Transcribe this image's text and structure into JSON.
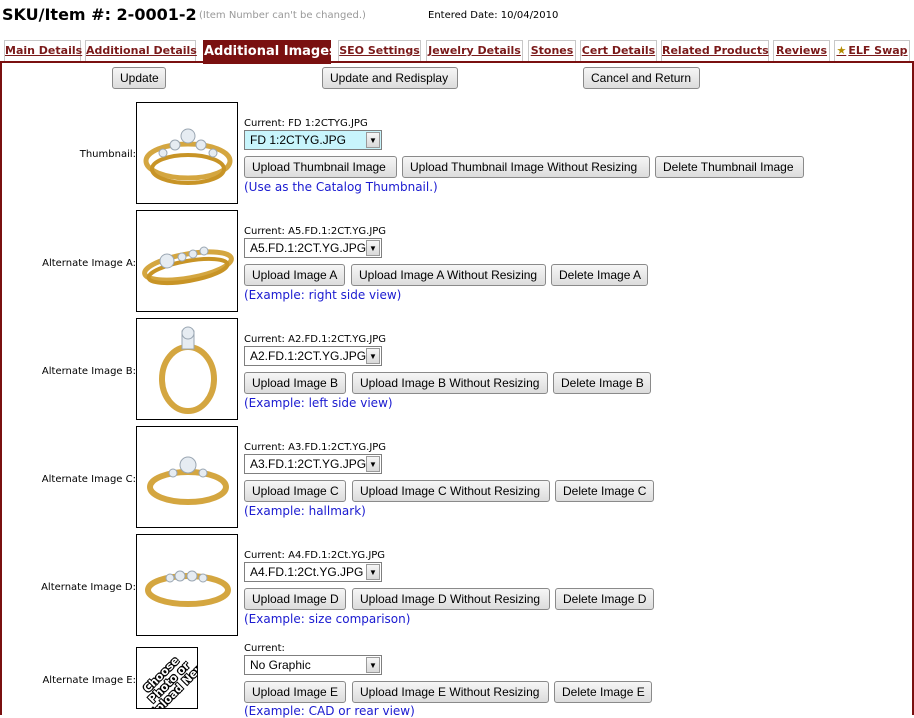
{
  "header": {
    "sku_title": "SKU/Item #: 2-0001-2",
    "sku_note": "(Item Number can't be changed.)",
    "entered_date": "Entered Date: 10/04/2010"
  },
  "tabs": [
    {
      "label": "Main Details"
    },
    {
      "label": "Additional Details"
    },
    {
      "label": "Additional Images",
      "active": true
    },
    {
      "label": "SEO Settings"
    },
    {
      "label": "Jewelry Details"
    },
    {
      "label": "Stones"
    },
    {
      "label": "Cert Details"
    },
    {
      "label": "Related Products"
    },
    {
      "label": "Reviews"
    },
    {
      "label": "ELF Swap",
      "icon": "star-icon"
    }
  ],
  "actions": {
    "update": "Update",
    "update_redisplay": "Update and Redisplay",
    "cancel_return": "Cancel and Return"
  },
  "rows": [
    {
      "label": "Thumbnail:",
      "current": "Current: FD 1:2CTYG.JPG",
      "selected": "FD 1:2CTYG.JPG",
      "btn_upload": "Upload Thumbnail Image",
      "btn_upload_nr": "Upload Thumbnail Image Without Resizing",
      "btn_delete": "Delete Thumbnail Image",
      "hint": "(Use as the Catalog Thumbnail.)"
    },
    {
      "label": "Alternate Image A:",
      "current": "Current: A5.FD.1:2CT.YG.JPG",
      "selected": "A5.FD.1:2CT.YG.JPG",
      "btn_upload": "Upload Image A",
      "btn_upload_nr": "Upload Image A Without Resizing",
      "btn_delete": "Delete Image A",
      "hint": "(Example: right side view)"
    },
    {
      "label": "Alternate Image B:",
      "current": "Current: A2.FD.1:2CT.YG.JPG",
      "selected": "A2.FD.1:2CT.YG.JPG",
      "btn_upload": "Upload Image B",
      "btn_upload_nr": "Upload Image B Without Resizing",
      "btn_delete": "Delete Image B",
      "hint": "(Example: left side view)"
    },
    {
      "label": "Alternate Image C:",
      "current": "Current: A3.FD.1:2CT.YG.JPG",
      "selected": "A3.FD.1:2CT.YG.JPG",
      "btn_upload": "Upload Image C",
      "btn_upload_nr": "Upload Image C Without Resizing",
      "btn_delete": "Delete Image C",
      "hint": "(Example: hallmark)"
    },
    {
      "label": "Alternate Image D:",
      "current": "Current: A4.FD.1:2Ct.YG.JPG",
      "selected": "A4.FD.1:2Ct.YG.JPG",
      "btn_upload": "Upload Image D",
      "btn_upload_nr": "Upload Image D Without Resizing",
      "btn_delete": "Delete Image D",
      "hint": "(Example: size comparison)"
    },
    {
      "label": "Alternate Image E:",
      "current": "Current:",
      "selected": "No Graphic",
      "btn_upload": "Upload Image E",
      "btn_upload_nr": "Upload Image E Without Resizing",
      "btn_delete": "Delete Image E",
      "hint": "(Example: CAD or rear view)",
      "placeholder_text": "Choose Photo or Upload New"
    }
  ],
  "colors": {
    "brand": "#7a1010",
    "hint": "#1a1ad0",
    "highlight_select": "#c8f5fc"
  }
}
